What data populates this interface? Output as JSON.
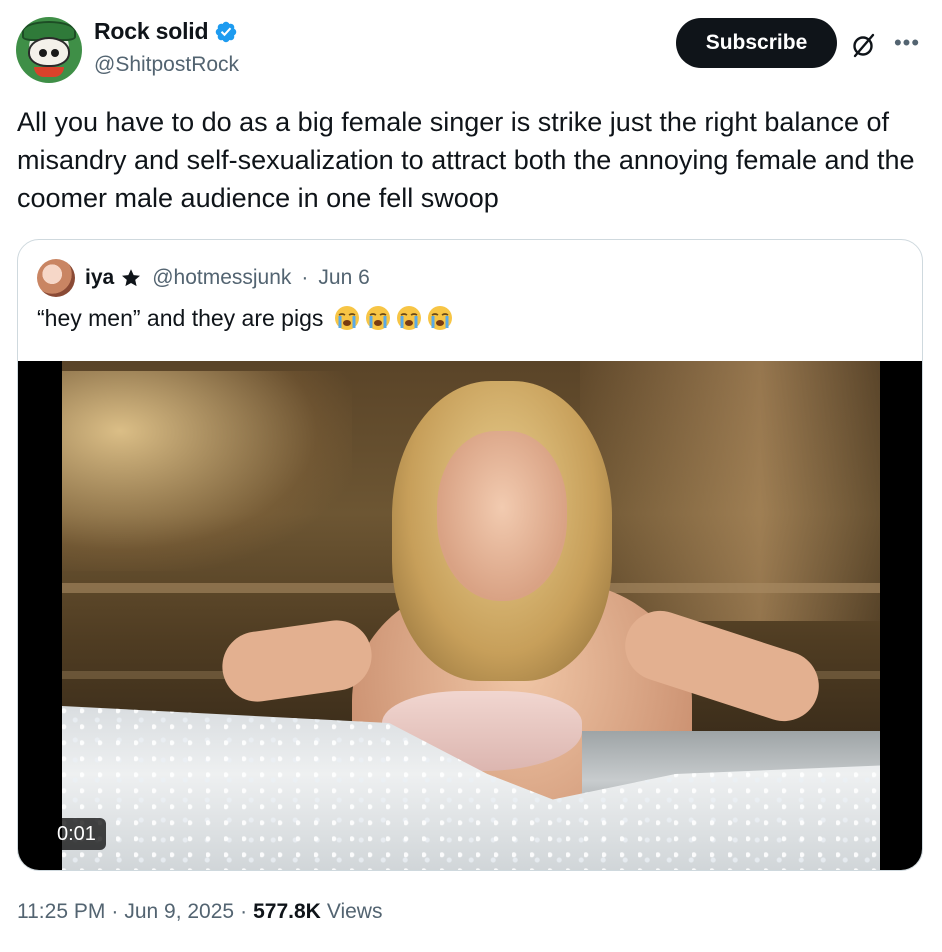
{
  "author": {
    "display_name": "Rock solid",
    "handle": "@ShitpostRock",
    "verified": true,
    "avatar_icon": "cartoon-avatar-icon"
  },
  "actions": {
    "subscribe_label": "Subscribe",
    "grok_icon": "grok-icon",
    "more_icon": "more-icon"
  },
  "tweet": {
    "text": "All you have to do as a big female singer is strike just the right balance of misandry and self-sexualization to attract both the annoying female and the coomer male audience in one fell swoop"
  },
  "quoted_tweet": {
    "display_name": "iya",
    "handle": "@hotmessjunk",
    "separator": "·",
    "date": "Jun 6",
    "text": "“hey men” and they are pigs",
    "emojis": [
      "loudly-crying-face",
      "loudly-crying-face",
      "loudly-crying-face",
      "loudly-crying-face"
    ],
    "video_time": "0:01"
  },
  "meta": {
    "time": "11:25 PM",
    "sep1": "·",
    "date": "Jun 9, 2025",
    "sep2": "·",
    "views_count": "577.8K",
    "views_label": "Views"
  },
  "colors": {
    "text_primary": "#0f1419",
    "text_secondary": "#536471",
    "verified_blue": "#1d9bf0",
    "border": "#cfd9de",
    "subscribe_bg": "#0f1419"
  }
}
